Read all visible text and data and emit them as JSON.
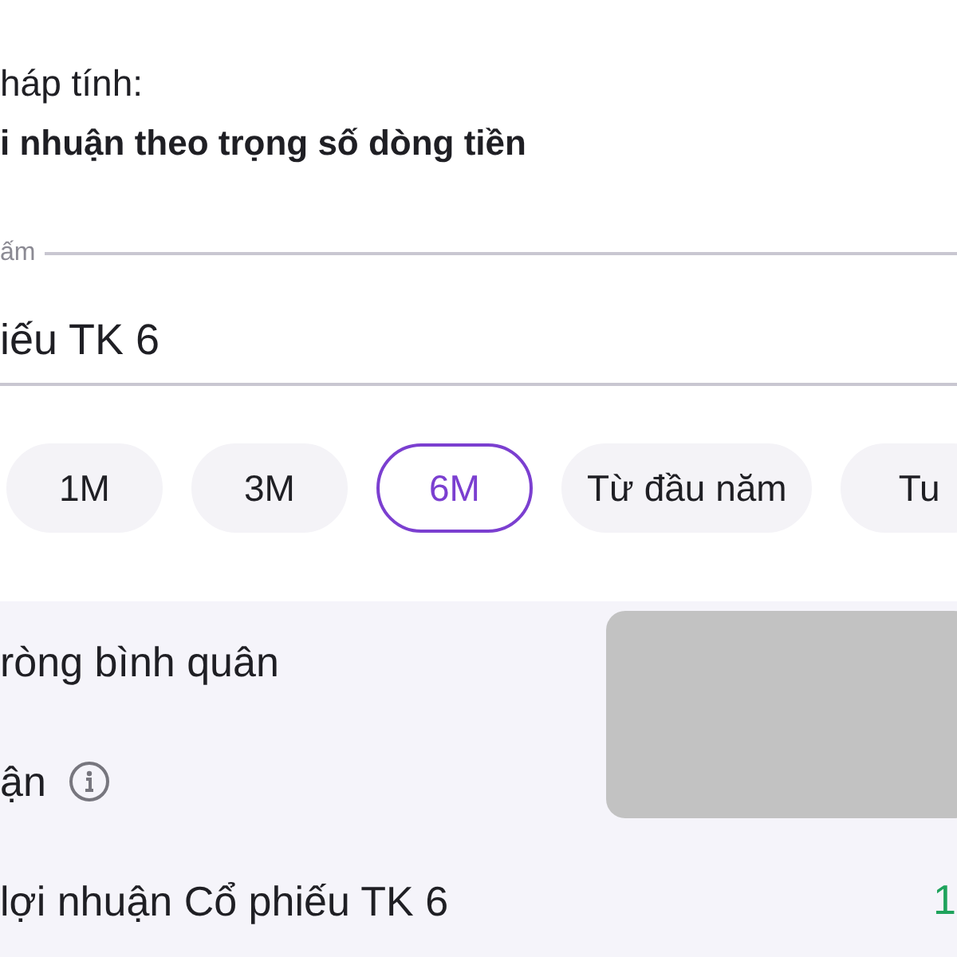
{
  "method": {
    "label": "háp tính:",
    "value": "i nhuận theo trọng số dòng tiền"
  },
  "product_field": {
    "label": "ấm",
    "value": "iếu TK 6"
  },
  "periods": [
    {
      "label": "1M",
      "selected": false
    },
    {
      "label": "3M",
      "selected": false
    },
    {
      "label": "6M",
      "selected": true
    },
    {
      "label": "Từ đầu năm",
      "selected": false
    },
    {
      "label": "Tu",
      "selected": false
    }
  ],
  "stats": [
    {
      "label": "ròng bình quân",
      "info": false
    },
    {
      "label": "ận",
      "info": true
    },
    {
      "label": "lợi nhuận Cổ phiếu TK 6",
      "info": false,
      "value": "1"
    }
  ]
}
